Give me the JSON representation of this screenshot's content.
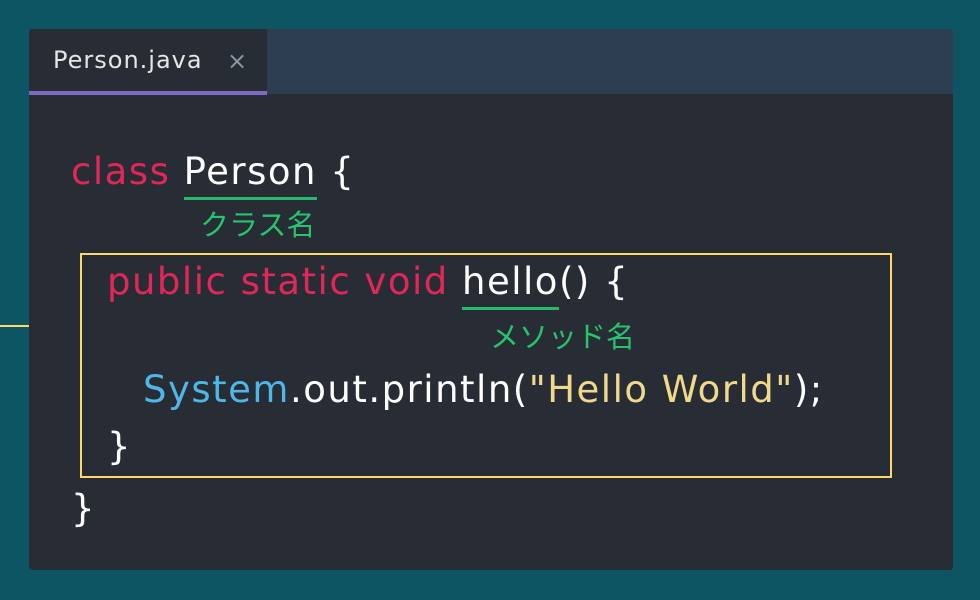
{
  "tab": {
    "filename": "Person.java",
    "close_glyph": "×"
  },
  "code": {
    "line1": {
      "keyword": "class",
      "class_name": "Person",
      "brace": "{"
    },
    "line2": {
      "keywords": "public static void",
      "method_name": "hello",
      "rest": "() {"
    },
    "line3": {
      "type": "System",
      "call": ".out.println(",
      "string": "\"Hello World\"",
      "end": ");"
    },
    "line4": "}",
    "line5": "}"
  },
  "annotations": {
    "class_name_label": "クラス名",
    "method_name_label": "メソッド名"
  },
  "colors": {
    "background": "#0d5562",
    "editor": "#282c34",
    "keyword": "#e12757",
    "type": "#4fb6e8",
    "string": "#f0d98b",
    "annotation": "#27c46f",
    "highlight_box": "#ffd866",
    "tab_accent": "#7c6ac5"
  }
}
